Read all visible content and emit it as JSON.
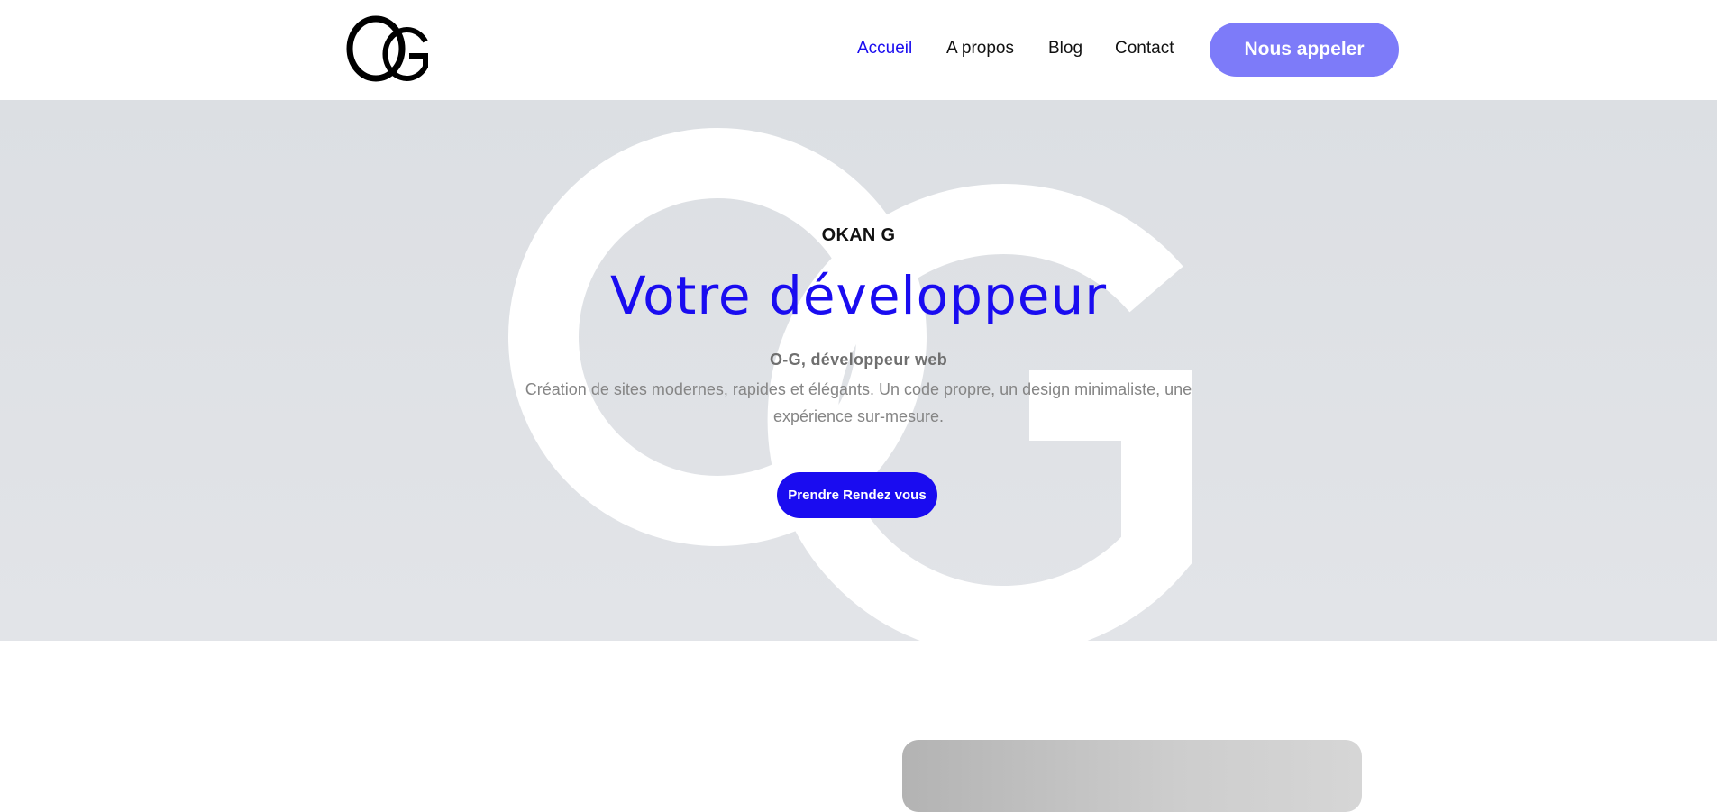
{
  "header": {
    "logo_text": "OG",
    "nav": [
      {
        "label": "Accueil",
        "active": true
      },
      {
        "label": "A propos",
        "active": false
      },
      {
        "label": "Blog",
        "active": false
      },
      {
        "label": "Contact",
        "active": false
      }
    ],
    "call_button_label": "Nous appeler"
  },
  "hero": {
    "watermark_text": "OG",
    "eyebrow": "OKAN G",
    "title": "Votre développeur",
    "subtitle": "O-G,  développeur web",
    "description": "Création de sites modernes, rapides et élégants. Un code propre, un design minimaliste, une expérience sur-mesure.",
    "cta_label": "Prendre Rendez vous"
  },
  "colors": {
    "accent": "#1a0cf0",
    "call_button": "#7d7bf9",
    "hero_background": "#dfe1e5"
  }
}
